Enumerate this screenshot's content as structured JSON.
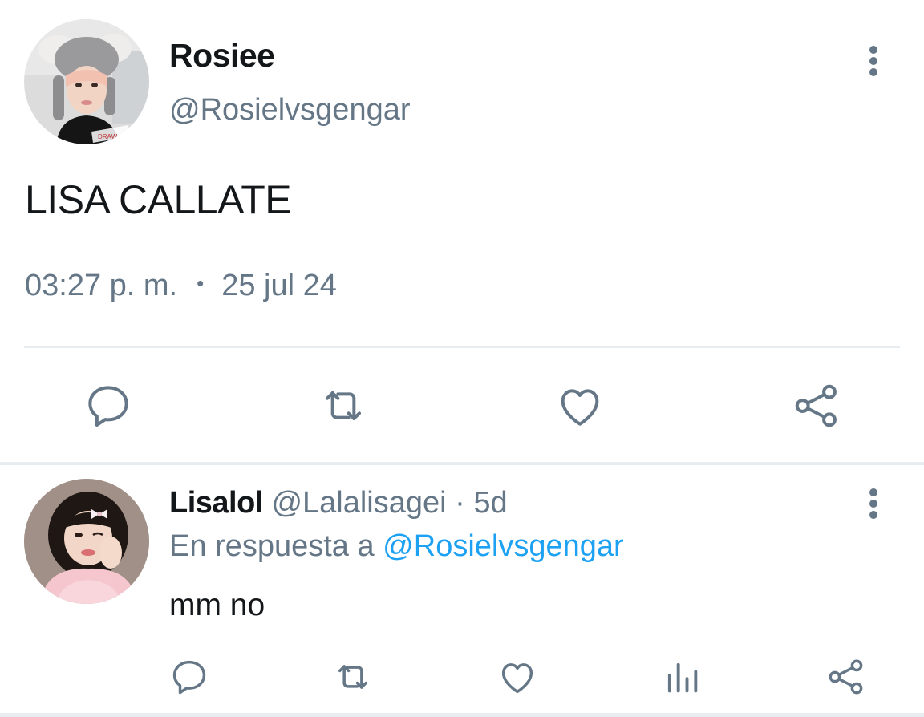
{
  "main_tweet": {
    "display_name": "Rosiee",
    "handle": "@Rosielvsgengar",
    "text": "LISA CALLATE",
    "time": "03:27 p. m.",
    "separator": "•",
    "date": "25 jul 24",
    "avatar_icon": "profile-photo-rosiee",
    "actions": [
      "reply-icon",
      "retweet-icon",
      "like-icon",
      "share-icon"
    ]
  },
  "reply": {
    "display_name": "Lisalol",
    "handle": "@Lalalisagei",
    "separator": "·",
    "age": "5d",
    "in_reply_prefix": "En respuesta a",
    "in_reply_to": "@Rosielvsgengar",
    "text": "mm no",
    "avatar_icon": "profile-photo-lisalol",
    "actions": [
      "reply-icon",
      "retweet-icon",
      "like-icon",
      "analytics-icon",
      "share-icon"
    ]
  },
  "colors": {
    "text_primary": "#14171a",
    "text_secondary": "#657786",
    "link": "#1da1f2",
    "divider": "#e6ecf0",
    "icon": "#657786"
  }
}
